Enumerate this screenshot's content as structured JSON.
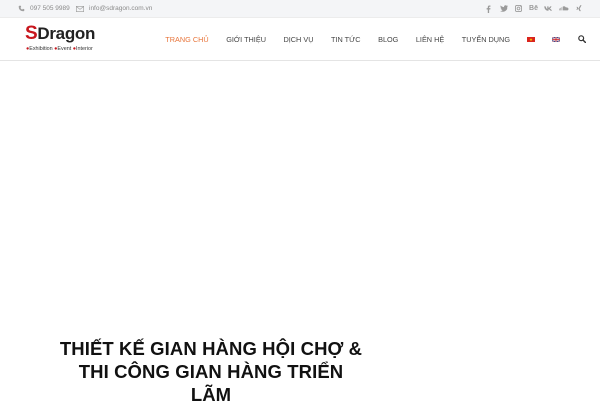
{
  "topbar": {
    "phone": "097 505 9989",
    "email": "info@sdragon.com.vn",
    "social_icons": [
      "facebook-icon",
      "twitter-icon",
      "instagram-icon",
      "behance-icon",
      "vk-icon",
      "soundcloud-icon",
      "xing-icon"
    ],
    "behance_glyph": "Bē"
  },
  "logo": {
    "letter": "S",
    "word": "Dragon",
    "tagline": [
      "Exhibition",
      "Event",
      "Interior"
    ],
    "bullet": "●"
  },
  "nav": {
    "items": [
      {
        "label": "Trang chủ",
        "active": true
      },
      {
        "label": "Giới thiệu",
        "active": false
      },
      {
        "label": "Dịch vụ",
        "active": false
      },
      {
        "label": "Tin tức",
        "active": false
      },
      {
        "label": "Blog",
        "active": false
      },
      {
        "label": "Liên hệ",
        "active": false
      },
      {
        "label": "Tuyển dụng",
        "active": false
      }
    ],
    "languages": [
      "vietnamese-flag-icon",
      "english-flag-icon"
    ]
  },
  "hero": {
    "title_line1": "THIẾT KẾ GIAN HÀNG HỘI CHỢ &",
    "title_line2": "THI CÔNG GIAN HÀNG TRIỂN",
    "title_line3": "LÃM"
  },
  "colors": {
    "accent": "#e8753b",
    "brand_red": "#c8161d",
    "topbar_bg": "#f4f5f7"
  }
}
